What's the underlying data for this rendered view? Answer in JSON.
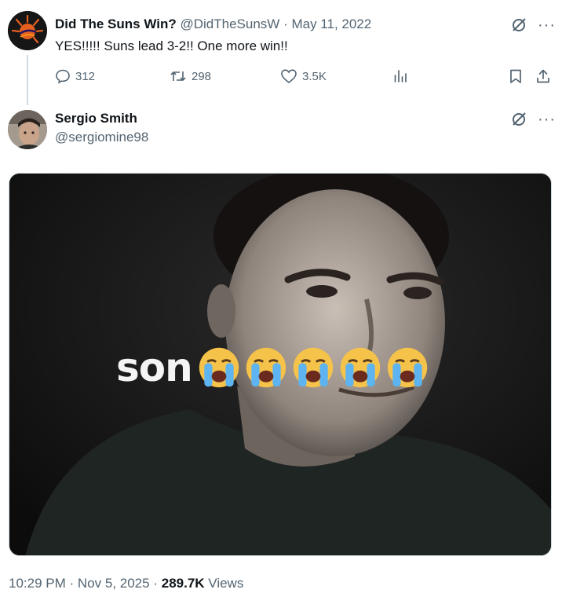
{
  "quoted_tweet": {
    "display_name": "Did The Suns Win?",
    "handle": "@DidTheSunsW",
    "separator": "·",
    "date": "May 11, 2022",
    "text": "YES!!!!! Suns lead 3-2!! One more win!!",
    "replies": "312",
    "retweets": "298",
    "likes": "3.5K",
    "more_label": "···",
    "avatar_icon": "suns-logo-icon"
  },
  "reply_tweet": {
    "display_name": "Sergio Smith",
    "handle": "@sergiomine98",
    "more_label": "···",
    "media": {
      "caption": "son",
      "emoji_count": 5,
      "emoji_icon": "loudly-crying-face-icon"
    }
  },
  "footer": {
    "time": "10:29 PM",
    "separator": "·",
    "date": "Nov 5, 2025",
    "views_count": "289.7K",
    "views_label": "Views"
  },
  "colors": {
    "text": "#0f1419",
    "muted": "#536471",
    "thread_line": "#cfd9de",
    "suns_orange": "#e56020",
    "suns_purple": "#1d1160"
  }
}
